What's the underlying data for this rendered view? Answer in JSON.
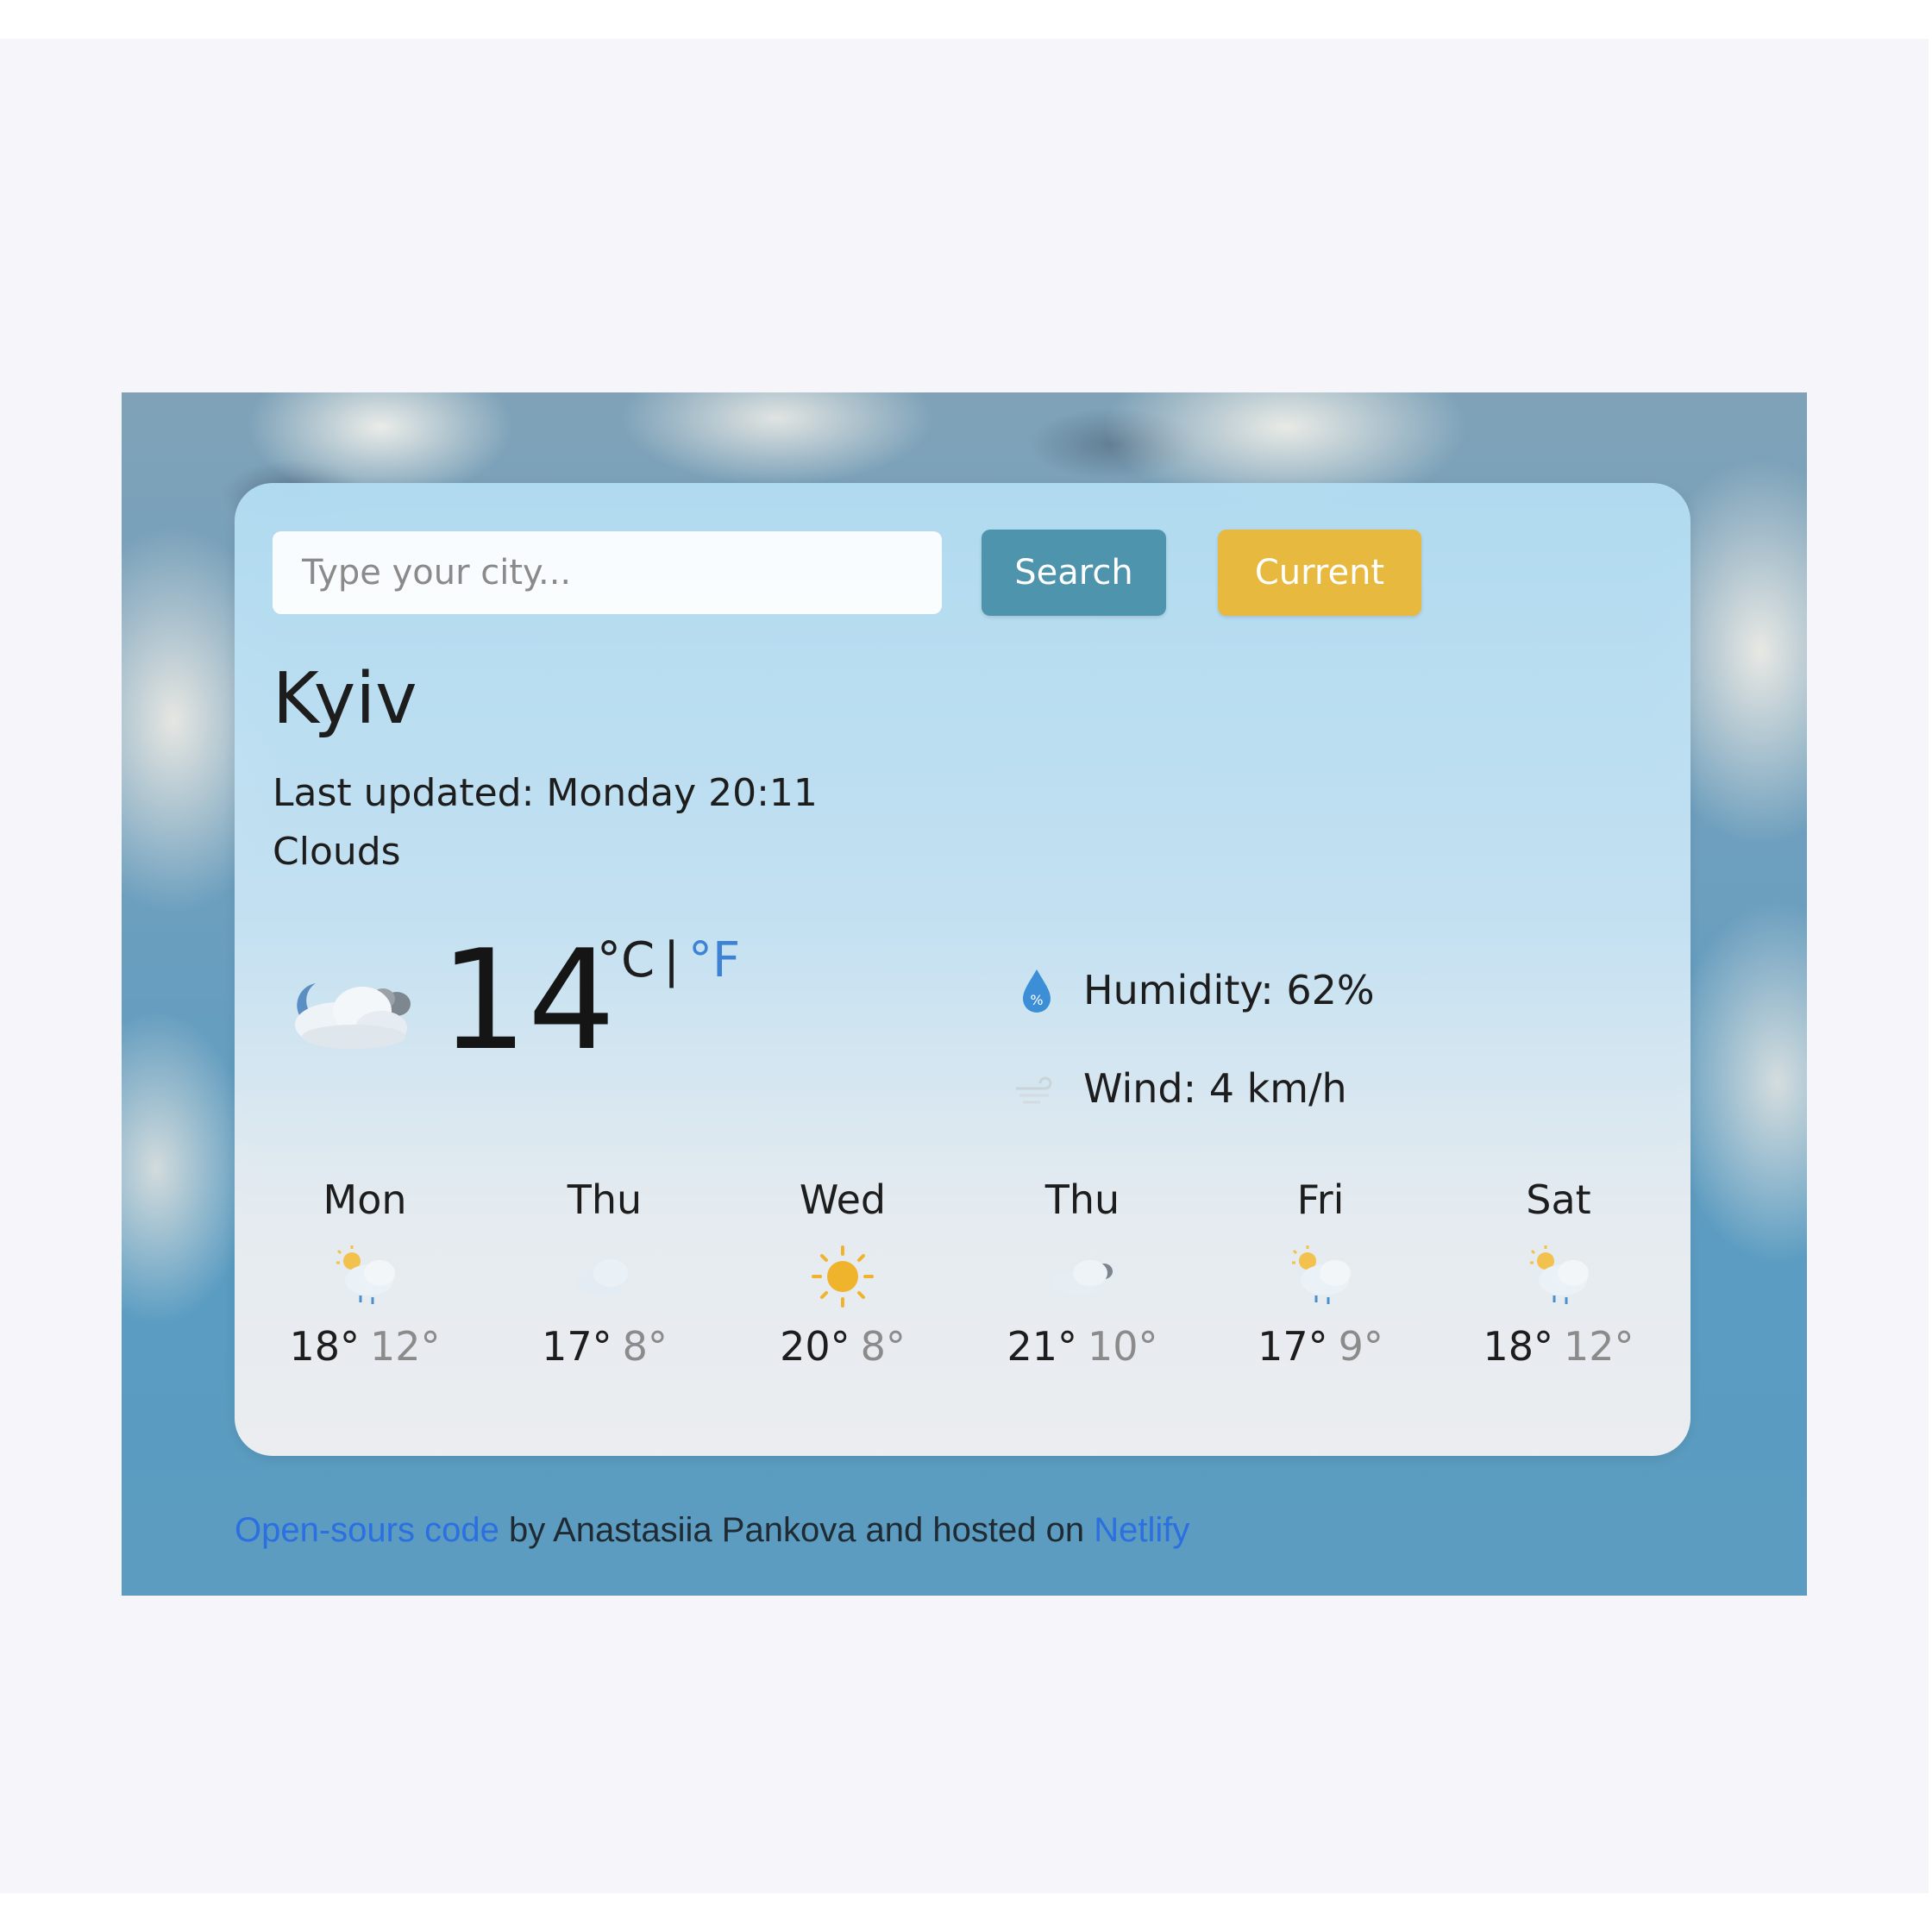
{
  "search": {
    "placeholder": "Type your city...",
    "search_label": "Search",
    "current_label": "Current"
  },
  "city": "Kyiv",
  "updated": "Last updated: Monday 20:11",
  "description": "Clouds",
  "main_icon": "cloud-night-icon",
  "temperature": {
    "value": "14",
    "unit_c": "°C",
    "separator": "|",
    "unit_f": "°F"
  },
  "details": {
    "humidity": "Humidity: 62%",
    "wind": "Wind: 4 km/h"
  },
  "forecast": [
    {
      "day": "Mon",
      "icon": "sun-rain-icon",
      "max": "18°",
      "min": "12°"
    },
    {
      "day": "Thu",
      "icon": "cloud-icon",
      "max": "17°",
      "min": "8°"
    },
    {
      "day": "Wed",
      "icon": "sun-icon",
      "max": "20°",
      "min": "8°"
    },
    {
      "day": "Thu",
      "icon": "cloud-night-icon",
      "max": "21°",
      "min": "10°"
    },
    {
      "day": "Fri",
      "icon": "sun-rain-icon",
      "max": "17°",
      "min": "9°"
    },
    {
      "day": "Sat",
      "icon": "sun-rain-icon",
      "max": "18°",
      "min": "12°"
    }
  ],
  "footer": {
    "link_code": "Open-sours code",
    "text_mid": " by Anastasiia Pankova and hosted on ",
    "link_host": "Netlify"
  },
  "colors": {
    "search_button": "#4f94ad",
    "current_button": "#e7b93e",
    "fahrenheit_link": "#3d82d4",
    "footer_link": "#2b6fe0"
  }
}
